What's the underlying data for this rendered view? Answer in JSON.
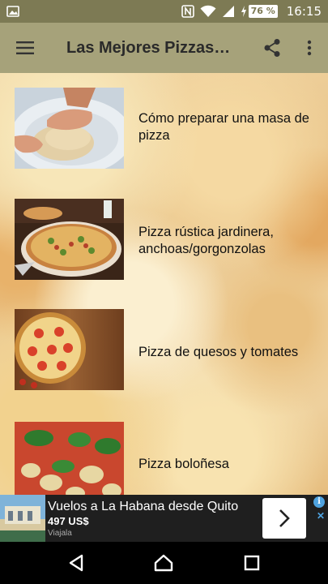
{
  "status_bar": {
    "time": "16:15",
    "battery": "76 %",
    "icons": [
      "image-icon",
      "nfc-icon",
      "wifi-icon",
      "signal-icon",
      "battery-charging-icon"
    ]
  },
  "app_bar": {
    "title": "Las Mejores Pizzas…",
    "menu_icon": "hamburger-menu-icon",
    "share_icon": "share-icon",
    "overflow_icon": "more-vert-icon",
    "background": "#a6a27a"
  },
  "list": {
    "items": [
      {
        "label": "Cómo preparar una masa de pizza",
        "thumbnail": "dough-kneading"
      },
      {
        "label": "Pizza rústica jardinera, anchoas/gorgonzolas",
        "thumbnail": "rustic-pizza"
      },
      {
        "label": "Pizza de quesos y tomates",
        "thumbnail": "cheese-tomato-pizza"
      },
      {
        "label": "Pizza boloñesa",
        "thumbnail": "bolognese-pizza"
      }
    ]
  },
  "ad": {
    "title": "Vuelos a La Habana desde Quito",
    "price": "497 US$",
    "source": "Viajala",
    "info_icon": "info-icon",
    "close_icon": "close-icon",
    "arrow_icon": "chevron-right-icon"
  },
  "nav_bar": {
    "back_icon": "back-triangle-icon",
    "home_icon": "home-icon",
    "recents_icon": "recents-square-icon"
  }
}
